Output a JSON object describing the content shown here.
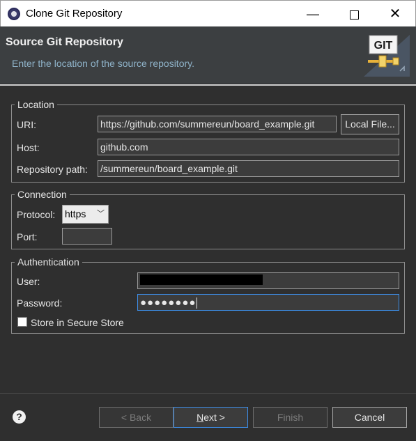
{
  "window": {
    "title": "Clone Git Repository",
    "minimize": "—",
    "close": "✕"
  },
  "banner": {
    "title": "Source Git Repository",
    "description": "Enter the location of the source repository.",
    "logo_text": "GIT"
  },
  "location": {
    "legend": "Location",
    "uri_label": "URI:",
    "uri_value": "https://github.com/summereun/board_example.git",
    "local_file_button": "Local File...",
    "host_label": "Host:",
    "host_value": "github.com",
    "repo_path_label": "Repository path:",
    "repo_path_value": "/summereun/board_example.git"
  },
  "connection": {
    "legend": "Connection",
    "protocol_label": "Protocol:",
    "protocol_value": "https",
    "port_label": "Port:",
    "port_value": ""
  },
  "authentication": {
    "legend": "Authentication",
    "user_label": "User:",
    "password_label": "Password:",
    "password_dots": "●●●●●●●●",
    "store_label": "Store in Secure Store",
    "store_checked": false
  },
  "footer": {
    "back_label": "< Back",
    "next_prefix": "N",
    "next_rest": "ext >",
    "finish_label": "Finish",
    "cancel_label": "Cancel"
  }
}
